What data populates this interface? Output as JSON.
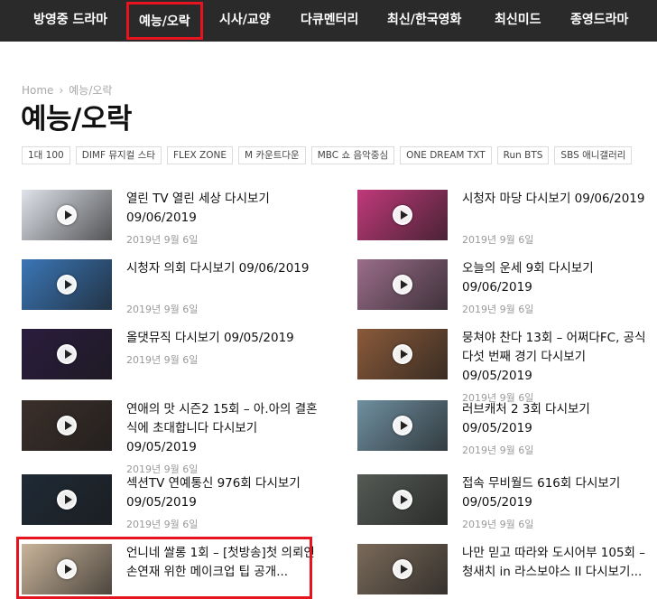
{
  "nav": [
    {
      "label": "방영중 드라마"
    },
    {
      "label": "예능/오락"
    },
    {
      "label": "시사/교양"
    },
    {
      "label": "다큐멘터리"
    },
    {
      "label": "최신/한국영화"
    },
    {
      "label": "최신미드"
    },
    {
      "label": "종영드라마"
    }
  ],
  "breadcrumb": {
    "home": "Home",
    "sep": "›",
    "current": "예능/오락"
  },
  "page_title": "예능/오락",
  "tags": [
    "1대 100",
    "DIMF 뮤지컬 스타",
    "FLEX ZONE",
    "M 카운트다운",
    "MBC 쇼 음악중심",
    "ONE DREAM TXT",
    "Run BTS",
    "SBS 애니갤러리"
  ],
  "posts": [
    {
      "title": "열린 TV 열린 세상 다시보기 09/06/2019",
      "date": "2019년 9월 6일",
      "bg": "#dfe3ea"
    },
    {
      "title": "시청자 마당 다시보기 09/06/2019",
      "date": "2019년 9월 6일",
      "bg": "#c0397a"
    },
    {
      "title": "시청자 의회 다시보기 09/06/2019",
      "date": "2019년 9월 6일",
      "bg": "#3a76b6"
    },
    {
      "title": "오늘의 운세 9회 다시보기 09/06/2019",
      "date": "2019년 9월 6일",
      "bg": "#9a6d8a"
    },
    {
      "title": "올댓뮤직 다시보기 09/05/2019",
      "date": "2019년 9월 6일",
      "bg": "#2a1c3e"
    },
    {
      "title": "뭉쳐야 찬다 13회 – 어쩌다FC, 공식 다섯 번째 경기 다시보기 09/05/2019",
      "date": "2019년 9월 6일",
      "bg": "#8a5a3a"
    },
    {
      "title": "연애의 맛 시즌2 15회 – 아.아의 결혼식에 초대합니다 다시보기 09/05/2019",
      "date": "2019년 9월 6일",
      "bg": "#3b2f2a"
    },
    {
      "title": "러브캐처 2 3회 다시보기 09/05/2019",
      "date": "2019년 9월 6일",
      "bg": "#6f8fa0"
    },
    {
      "title": "섹션TV 연예통신 976회 다시보기 09/05/2019",
      "date": "2019년 9월 6일",
      "bg": "#1f2a36"
    },
    {
      "title": "접속 무비월드 616회 다시보기 09/05/2019",
      "date": "2019년 9월 6일",
      "bg": "#555a55"
    },
    {
      "title": "언니네 쌀롱 1회 – [첫방송]첫 의뢰인 손연재 위한 메이크업 팁 공개...",
      "date": "",
      "bg": "#c9b49a"
    },
    {
      "title": "나만 믿고 따라와 도시어부 105회 – 청새치 in 라스보야스 II 다시보기...",
      "date": "",
      "bg": "#7a6a5a"
    }
  ],
  "colors": {
    "nav_bg": "#2a2a2a",
    "highlight": "#e5141e",
    "date": "#9a9a9a"
  }
}
